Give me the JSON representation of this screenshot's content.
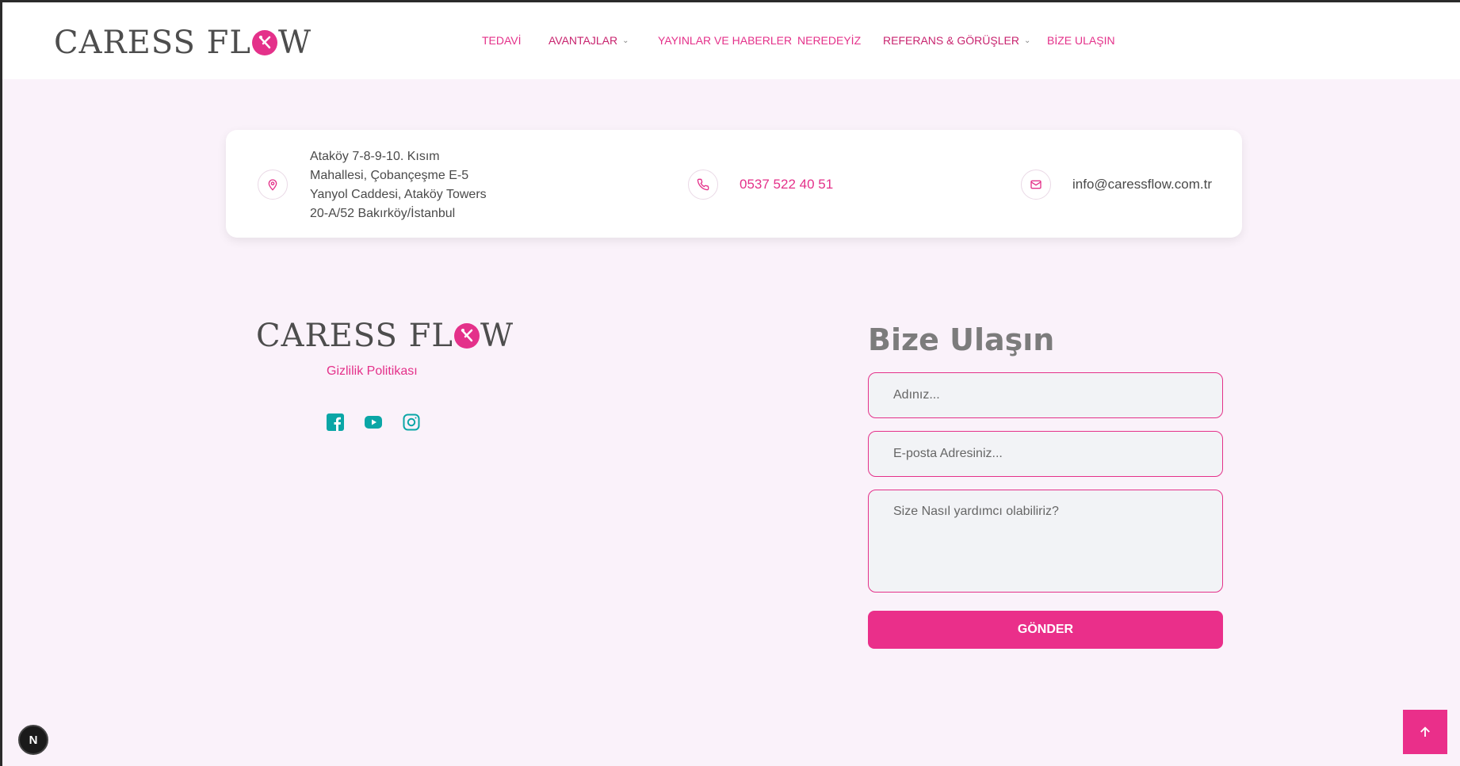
{
  "brand": {
    "name_before": "CARESS FL",
    "name_after": "W",
    "accent": "#e4318a"
  },
  "nav": {
    "items": [
      {
        "label": "TEDAVİ"
      },
      {
        "label": "AVANTAJLAR"
      },
      {
        "label": "YAYINLAR VE HABERLER"
      },
      {
        "label": "NEREDEYİZ"
      },
      {
        "label": "REFERANS & GÖRÜŞLER"
      },
      {
        "label": "BİZE ULAŞIN"
      }
    ],
    "dropdown_icon": "chevron-down-icon"
  },
  "contact": {
    "address_lines": [
      "Ataköy 7-8-9-10. Kısım",
      "Mahallesi, Çobançeşme E-5",
      "Yanyol Caddesi, Ataköy Towers",
      "20-A/52 Bakırköy/İstanbul"
    ],
    "phone": "0537 522 40 51",
    "email": "info@caressflow.com.tr",
    "icons": [
      "location-pin-icon",
      "phone-icon",
      "mail-icon"
    ]
  },
  "footer": {
    "privacy_label": "Gizlilik Politikası",
    "social": [
      "facebook-icon",
      "youtube-icon",
      "instagram-icon"
    ],
    "social_color": "#0aa6a6"
  },
  "form": {
    "title": "Bize Ulaşın",
    "name_placeholder": "Adınız...",
    "email_placeholder": "E-posta Adresiniz...",
    "message_placeholder": "Size Nasıl yardımcı olabiliriz?",
    "submit_label": "GÖNDER"
  },
  "floating": {
    "next_badge": "N",
    "scroll_top_icon": "arrow-up-icon"
  }
}
